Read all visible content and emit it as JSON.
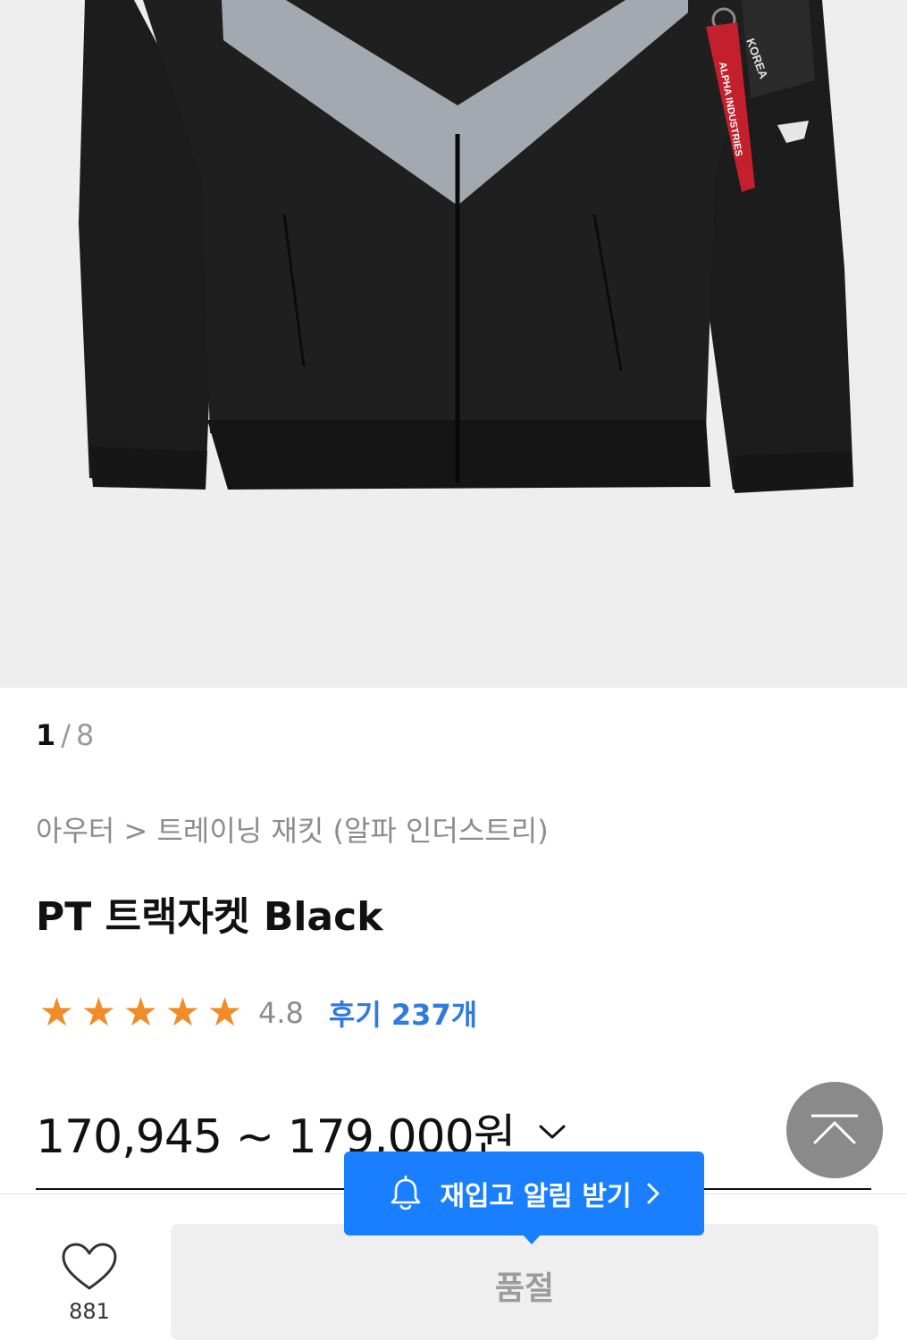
{
  "product_image": {
    "brand_tag": "ALPHA INDUSTRIES",
    "country_tag": "KOREA"
  },
  "gallery": {
    "current": "1",
    "separator": "/",
    "total": "8"
  },
  "breadcrumb": "아우터 > 트레이닝 재킷 (알파 인더스트리)",
  "product": {
    "title": "PT 트랙자켓 Black",
    "rating": 4.8,
    "rating_text": "4.8",
    "review_link": "후기 237개",
    "price_range": "170,945 ~ 179,000원"
  },
  "restock_alert": {
    "label": "재입고 알림 받기",
    "icon": "bell-icon"
  },
  "like": {
    "count": "881",
    "icon": "heart-icon"
  },
  "purchase_button": {
    "label": "품절"
  },
  "colors": {
    "accent": "#1a7fff",
    "star": "#f28c28",
    "review_link": "#2f7be0",
    "soldout_bg": "#efefef",
    "scroll_top_bg": "#8a8a8a"
  }
}
